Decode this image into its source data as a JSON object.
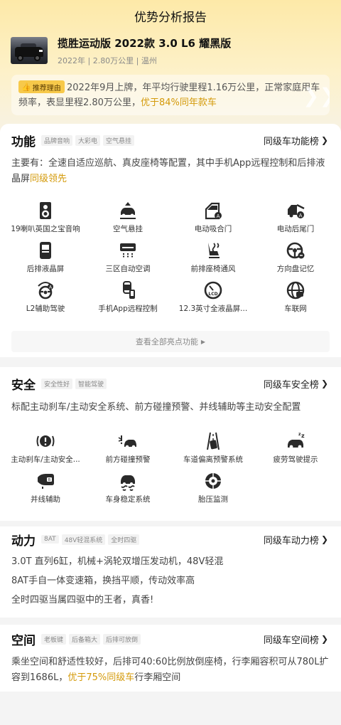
{
  "page": {
    "title": "优势分析报告"
  },
  "car": {
    "name": "揽胜运动版 2022款 3.0 L6 耀黑版",
    "meta": "2022年 | 2.80万公里 | 温州"
  },
  "reason": {
    "tag": "推荐理由",
    "text_plain": "2022年9月上牌，年平均行驶里程1.16万公里，正常家庭用车频率，表显里程2.80万公里，",
    "text_highlight": "优于84%同年款车"
  },
  "sections": {
    "function": {
      "title": "功能",
      "tags": [
        "品牌音响",
        "大彩电",
        "空气悬挂"
      ],
      "link": "同级车功能榜",
      "desc_plain": "主要有：全速自适应巡航、真皮座椅等配置，其中手机App远程控制和后排液晶屏",
      "desc_highlight": "同级领先",
      "features": [
        {
          "label": "19喇叭英国之宝音响",
          "icon": "speaker-icon"
        },
        {
          "label": "空气悬挂",
          "icon": "air-suspension-icon"
        },
        {
          "label": "电动吸合门",
          "icon": "soft-close-door-icon"
        },
        {
          "label": "电动后尾门",
          "icon": "power-tailgate-icon"
        },
        {
          "label": "后排液晶屏",
          "icon": "rear-screen-icon"
        },
        {
          "label": "三区自动空调",
          "icon": "climate-icon"
        },
        {
          "label": "前排座椅通风",
          "icon": "seat-ventilation-icon"
        },
        {
          "label": "方向盘记忆",
          "icon": "steering-memory-icon"
        },
        {
          "label": "L2辅助驾驶",
          "icon": "assisted-driving-icon"
        },
        {
          "label": "手机App远程控制",
          "icon": "phone-remote-icon"
        },
        {
          "label": "12.3英寸全液晶屏...",
          "icon": "lcd-cluster-icon"
        },
        {
          "label": "车联网",
          "icon": "connected-car-icon"
        }
      ],
      "more": "查看全部亮点功能"
    },
    "safety": {
      "title": "安全",
      "tags": [
        "安全性好",
        "智能驾驶"
      ],
      "link": "同级车安全榜",
      "desc": "标配主动刹车/主动安全系统、前方碰撞预警、并线辅助等主动安全配置",
      "features": [
        {
          "label": "主动刹车/主动安全...",
          "icon": "active-brake-icon"
        },
        {
          "label": "前方碰撞预警",
          "icon": "collision-warning-icon"
        },
        {
          "label": "车道偏离预警系统",
          "icon": "lane-departure-icon"
        },
        {
          "label": "疲劳驾驶提示",
          "icon": "fatigue-alert-icon"
        },
        {
          "label": "并线辅助",
          "icon": "blind-spot-icon"
        },
        {
          "label": "车身稳定系统",
          "icon": "stability-control-icon"
        },
        {
          "label": "胎压监测",
          "icon": "tire-pressure-icon"
        }
      ]
    },
    "power": {
      "title": "动力",
      "tags": [
        "8AT",
        "48V轻混系统",
        "全时四驱"
      ],
      "link": "同级车动力榜",
      "lines": [
        "3.0T 直列6缸，机械+涡轮双增压发动机，48V轻混",
        "8AT手自一体变速箱，换挡平顺，传动效率高",
        "全时四驱当属四驱中的王者，真香!"
      ]
    },
    "space": {
      "title": "空间",
      "tags": [
        "老板键",
        "后备箱大",
        "后排可放倒"
      ],
      "link": "同级车空间榜",
      "desc_plain": "乘坐空间和舒适性较好，后排可40:60比例放倒座椅，行李厢容积可从780L扩容到1686L，",
      "desc_highlight": "优于75%同级车",
      "desc_tail": "行李厢空间"
    }
  },
  "colors": {
    "accent": "#d49a0a",
    "tag_bg": "#f7c94a",
    "hero_top": "#fde9a8"
  }
}
